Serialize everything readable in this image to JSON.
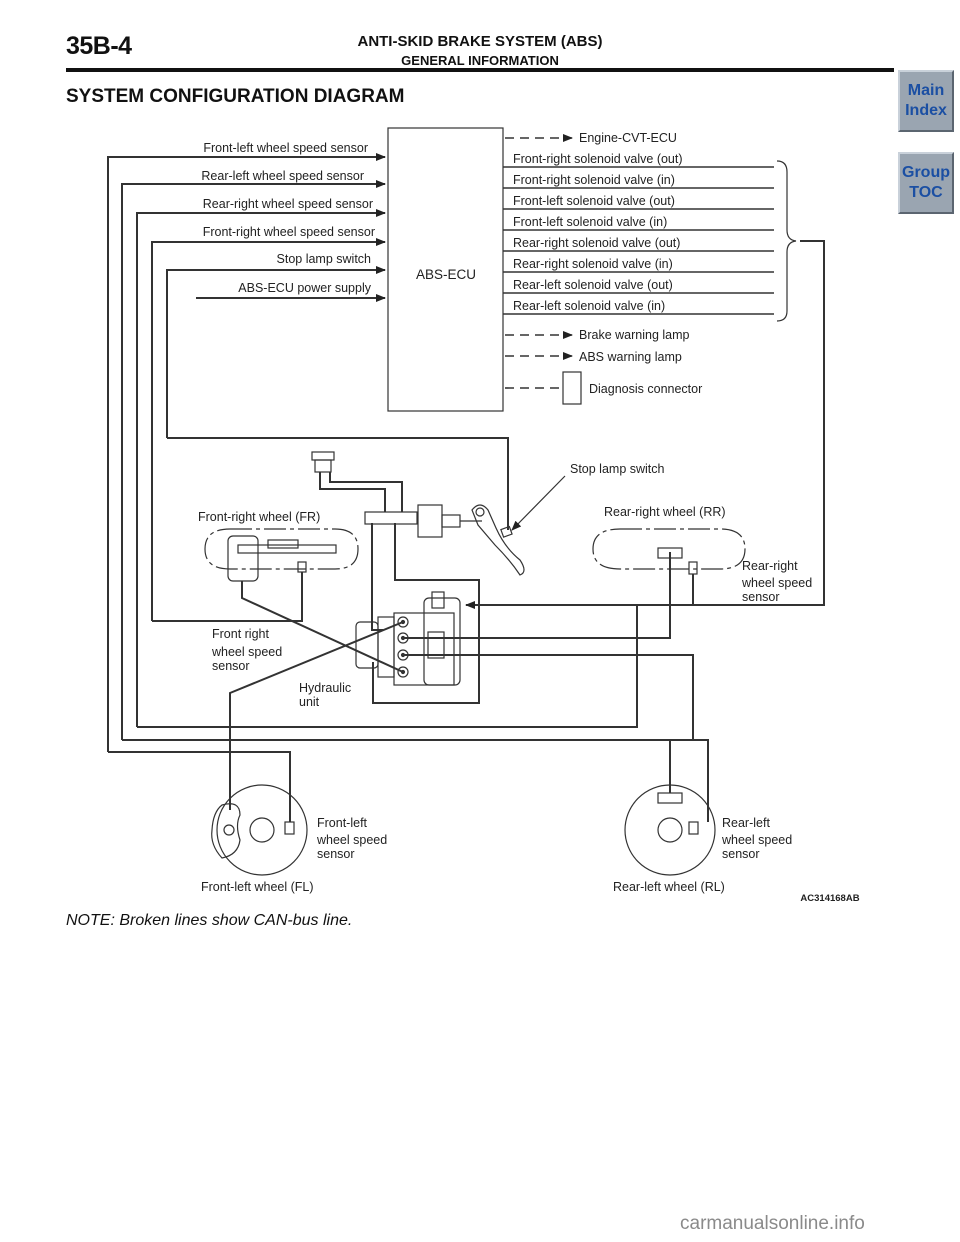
{
  "header": {
    "page_code": "35B-4",
    "title": "ANTI-SKID BRAKE SYSTEM (ABS)",
    "subtitle": "GENERAL INFORMATION"
  },
  "nav": {
    "main_index": [
      "Main",
      "Index"
    ],
    "group_toc": [
      "Group",
      "TOC"
    ]
  },
  "section_title": "SYSTEM CONFIGURATION DIAGRAM",
  "diagram": {
    "ecu_label": "ABS-ECU",
    "inputs": [
      "Front-left wheel speed sensor",
      "Rear-left wheel speed sensor",
      "Rear-right wheel speed sensor",
      "Front-right wheel speed sensor",
      "Stop lamp switch",
      "ABS-ECU power supply"
    ],
    "can_outputs_top": [
      "Engine-CVT-ECU"
    ],
    "solenoid_outputs": [
      "Front-right solenoid valve (out)",
      "Front-right solenoid valve (in)",
      "Front-left solenoid valve (out)",
      "Front-left solenoid valve (in)",
      "Rear-right solenoid valve (out)",
      "Rear-right solenoid valve (in)",
      "Rear-left solenoid valve (out)",
      "Rear-left solenoid valve (in)"
    ],
    "can_outputs_bottom": [
      "Brake warning lamp",
      "ABS warning lamp"
    ],
    "diagnosis_connector": "Diagnosis connector",
    "components": {
      "stop_lamp_switch": "Stop lamp switch",
      "front_right_wheel": "Front-right wheel (FR)",
      "rear_right_wheel": "Rear-right wheel (RR)",
      "rear_right_sensor": [
        "Rear-right",
        "wheel speed",
        "sensor"
      ],
      "front_right_sensor": [
        "Front right",
        "wheel speed",
        "sensor"
      ],
      "hydraulic_unit": [
        "Hydraulic",
        "unit"
      ],
      "front_left_sensor": [
        "Front-left",
        "wheel speed",
        "sensor"
      ],
      "rear_left_sensor": [
        "Rear-left",
        "wheel speed",
        "sensor"
      ],
      "front_left_wheel": "Front-left wheel (FL)",
      "rear_left_wheel": "Rear-left wheel (RL)"
    },
    "figure_id": "AC314168AB"
  },
  "note": "NOTE: Broken lines show CAN-bus line.",
  "watermark": "carmanualsonline.info"
}
